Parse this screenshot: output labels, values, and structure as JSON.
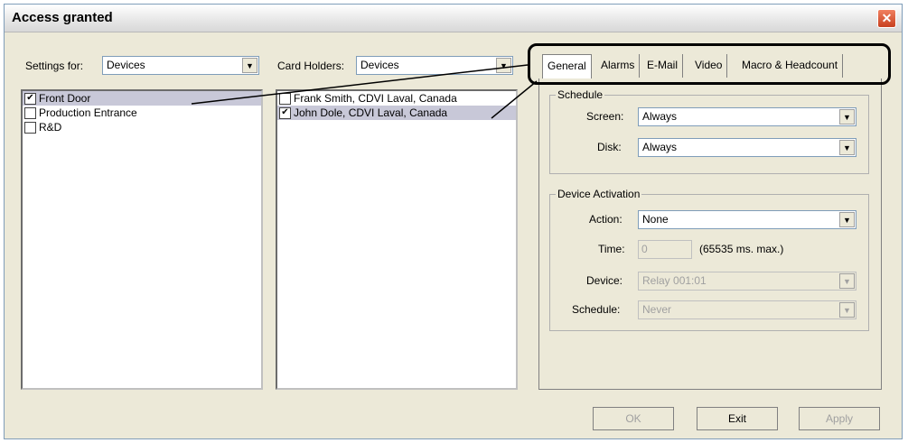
{
  "window": {
    "title": "Access granted"
  },
  "settings_for": {
    "label": "Settings for:",
    "value": "Devices"
  },
  "card_holders": {
    "label": "Card Holders:",
    "value": "Devices"
  },
  "devices_list": [
    {
      "label": "Front Door",
      "checked": true,
      "selected": true
    },
    {
      "label": "Production Entrance",
      "checked": false,
      "selected": false
    },
    {
      "label": "R&D",
      "checked": false,
      "selected": false
    }
  ],
  "card_holders_list": [
    {
      "label": "Frank Smith, CDVI Laval, Canada",
      "checked": false,
      "selected": false
    },
    {
      "label": "John Dole, CDVI Laval, Canada",
      "checked": true,
      "selected": true
    }
  ],
  "tabs": [
    "General",
    "Alarms",
    "E-Mail",
    "Video",
    "Macro & Headcount"
  ],
  "schedule": {
    "title": "Schedule",
    "screen_label": "Screen:",
    "screen_value": "Always",
    "disk_label": "Disk:",
    "disk_value": "Always"
  },
  "device_activation": {
    "title": "Device Activation",
    "action_label": "Action:",
    "action_value": "None",
    "time_label": "Time:",
    "time_value": "0",
    "time_hint": "(65535 ms. max.)",
    "device_label": "Device:",
    "device_value": "Relay 001:01",
    "schedule_label": "Schedule:",
    "schedule_value": "Never"
  },
  "buttons": {
    "ok": "OK",
    "exit": "Exit",
    "apply": "Apply"
  },
  "icons": {
    "close": "close-icon",
    "dropdown": "chevron-down-icon",
    "check": "checkmark-icon"
  }
}
